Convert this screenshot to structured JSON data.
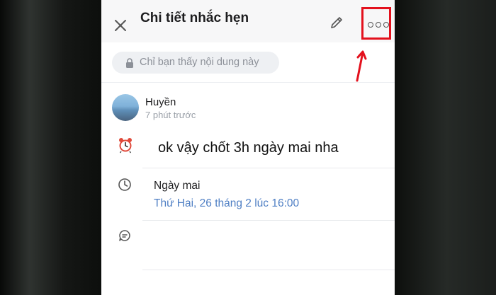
{
  "header": {
    "title": "Chi tiết nhắc hẹn"
  },
  "privacy": {
    "label": "Chỉ bạn thấy nội dung này"
  },
  "sender": {
    "name": "Huyền",
    "time": "7 phút trước"
  },
  "reminder": {
    "text": "ok vậy chốt 3h ngày mai nha"
  },
  "schedule": {
    "day_label": "Ngày mai",
    "datetime": "Thứ Hai, 26 tháng 2 lúc 16:00"
  },
  "colors": {
    "highlight_box": "#e3111d",
    "date_text": "#4f7fc4"
  },
  "icons": [
    "close-icon",
    "pencil-icon",
    "more-icon",
    "lock-icon",
    "alarm-clock-icon",
    "clock-icon",
    "note-icon",
    "arrow-up-icon"
  ]
}
